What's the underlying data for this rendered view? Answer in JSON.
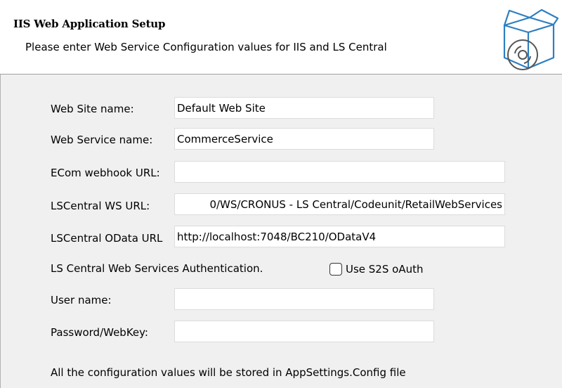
{
  "header": {
    "title": "IIS Web Application Setup",
    "subtitle": "Please enter Web Service Configuration values for IIS and LS Central",
    "icon": "software-box-cd-icon"
  },
  "form": {
    "website_name": {
      "label": "Web Site name:",
      "value": "Default Web Site"
    },
    "webservice_name": {
      "label": "Web Service name:",
      "value": "CommerceService"
    },
    "ecom_webhook_url": {
      "label": "ECom webhook URL:",
      "value": ""
    },
    "lscentral_ws_url": {
      "label": "LSCentral WS URL:",
      "value": "0/WS/CRONUS - LS Central/Codeunit/RetailWebServices"
    },
    "lscentral_odata_url": {
      "label": "LSCentral OData URL",
      "value": "http://localhost:7048/BC210/ODataV4"
    },
    "auth_label": "LS Central Web Services Authentication.",
    "s2s_checkbox": {
      "label": "Use S2S oAuth",
      "checked": false
    },
    "user_name": {
      "label": "User name:",
      "value": ""
    },
    "password": {
      "label": "Password/WebKey:",
      "value": ""
    }
  },
  "footer_note": "All the configuration values will be stored in AppSettings.Config file"
}
